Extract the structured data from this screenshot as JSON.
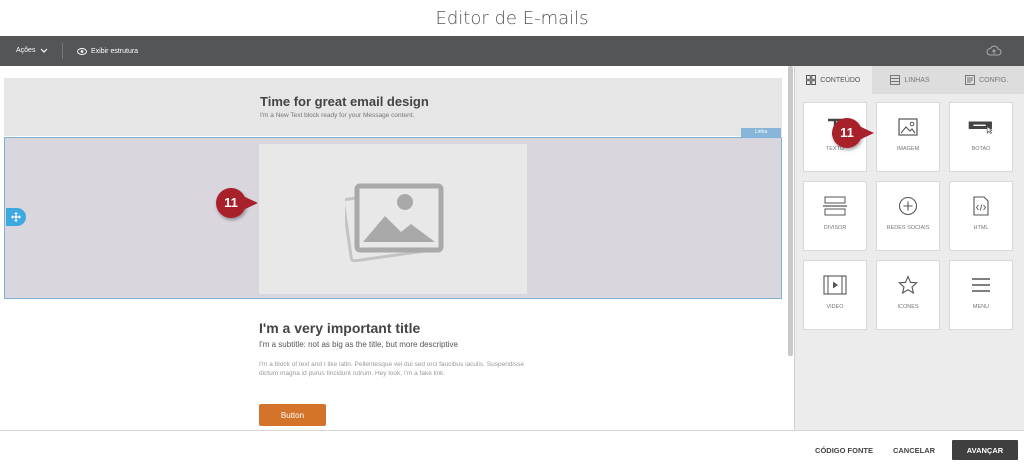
{
  "page": {
    "title": "Editor de E-mails"
  },
  "toolbar": {
    "acoes_label": "Ações",
    "estrutura_label": "Exibir estrutura"
  },
  "canvas": {
    "header_title": "Time for great email design",
    "header_subtitle": "I'm a New Text block ready for your Message content.",
    "row_tag": "Linha",
    "content_title": "I'm a very important title",
    "content_subtitle": "I'm a subtitle: not as big as the title, but more descriptive",
    "content_body": "I'm a block of text and I like latin. Pellentesque vel dui sed orci faucibus iaculis. Suspendisse dictum magna id purus tincidunt rutrum. Hey look, I'm a fake link.",
    "button_label": "Button"
  },
  "annotations": {
    "badge_left": "11",
    "badge_right": "11"
  },
  "panel": {
    "tabs": [
      {
        "label": "CONTEÚDO",
        "icon": "grid-icon"
      },
      {
        "label": "LINHAS",
        "icon": "rows-icon"
      },
      {
        "label": "CONFIG.",
        "icon": "settings-icon"
      }
    ],
    "tiles": [
      {
        "label": "TEXTO",
        "icon": "text-icon"
      },
      {
        "label": "IMAGEM",
        "icon": "image-icon"
      },
      {
        "label": "BOTAO",
        "icon": "button-icon"
      },
      {
        "label": "DIVISOR",
        "icon": "divider-icon"
      },
      {
        "label": "REDES SOCIAIS",
        "icon": "social-icon"
      },
      {
        "label": "HTML",
        "icon": "html-icon"
      },
      {
        "label": "VIDEO",
        "icon": "video-icon"
      },
      {
        "label": "ICONES",
        "icon": "star-icon"
      },
      {
        "label": "MENU",
        "icon": "menu-icon"
      }
    ]
  },
  "footer": {
    "codigo_fonte": "CÓDIGO FONTE",
    "cancelar": "CANCELAR",
    "avancar": "AVANÇAR"
  },
  "colors": {
    "topbar": "#535556",
    "accent": "#d4742b",
    "selection": "#7fb2da",
    "badge": "#a8202a"
  }
}
